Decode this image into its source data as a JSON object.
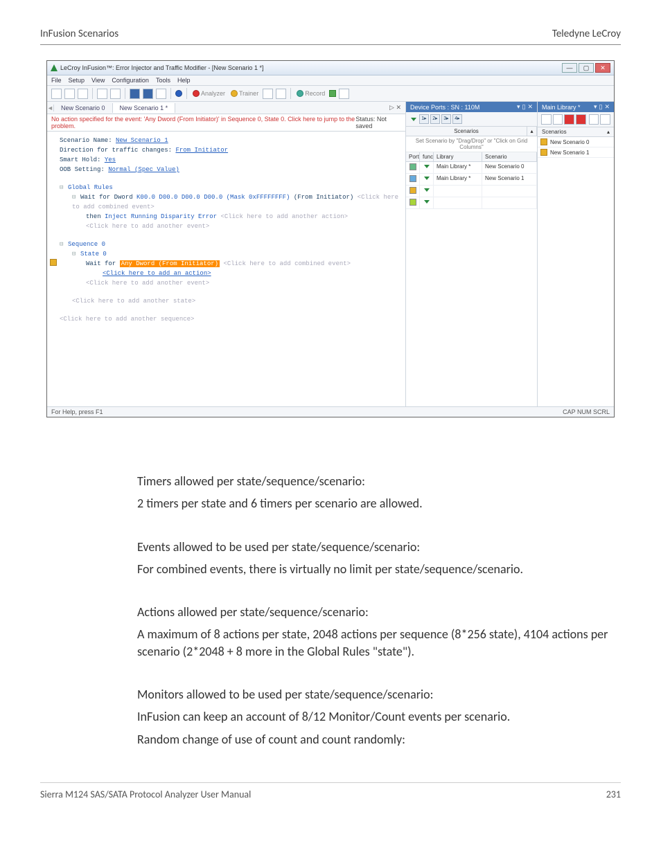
{
  "doc": {
    "header_left": "InFusion Scenarios",
    "header_right": "Teledyne LeCroy",
    "footer_left": "Sierra M124 SAS/SATA Protocol Analyzer User Manual",
    "footer_right": "231"
  },
  "win": {
    "title": "LeCroy InFusion™: Error Injector and Traffic Modifier - [New Scenario 1 *]",
    "menu": [
      "File",
      "Setup",
      "View",
      "Configuration",
      "Tools",
      "Help"
    ]
  },
  "toolbar": {
    "analyzer": "Analyzer",
    "trainer": "Trainer",
    "record": "Record"
  },
  "tabs": {
    "left_marker": "◄",
    "t0": "New Scenario 0",
    "t1": "New Scenario 1 *",
    "close_marker": "▷  ✕"
  },
  "warn": {
    "text": "No action specified for the event: 'Any Dword (From Initiator)' in Sequence 0, State 0.  Click here to jump to the problem.",
    "status": "Status: Not saved"
  },
  "editor": {
    "l1a": "Scenario Name: ",
    "l1b": "New Scenario 1",
    "l2a": "Direction for traffic changes: ",
    "l2b": "From Initiator",
    "l3a": "Smart Hold: ",
    "l3b": "Yes",
    "l4a": "OOB Setting: ",
    "l4b": "Normal (Spec Value)",
    "l5": "Global Rules",
    "l6a": "Wait for Dword ",
    "l6b": "K00.0 D00.0 D00.0 D00.0 (Mask 0xFFFFFFFF)",
    "l6c": " (From Initiator) ",
    "l6d": "<Click here to add combined event>",
    "l7a": "then ",
    "l7b": "Inject Running Disparity Error",
    "l7c": " <Click here to add another action>",
    "l8": "<Click here to add another event>",
    "l9": "Sequence 0",
    "l10": "State 0",
    "l11a": "Wait for ",
    "l11b": "Any Dword (From Initiator)",
    "l11c": " <Click here to add combined event>",
    "l12": "<Click here to add an action>",
    "l13": "<Click here to add another event>",
    "l14": "<Click here to add another state>",
    "l15": "<Click here to add another sequence>"
  },
  "mid": {
    "title": "Device Ports : SN : 110M",
    "hdr_scenarios": "Scenarios",
    "hint": "Set Scenario by \"Drag/Drop\" or \"Click on Grid Columns\"",
    "cols": {
      "port": "Port",
      "func": "func",
      "lib": "Library",
      "scen": "Scenario"
    },
    "rows": [
      {
        "port": "port-a",
        "lib": "Main Library *",
        "scen": "New Scenario 0"
      },
      {
        "port": "port-b",
        "lib": "Main Library *",
        "scen": "New Scenario 1"
      },
      {
        "port": "port-c",
        "lib": "",
        "scen": ""
      },
      {
        "port": "port-d",
        "lib": "",
        "scen": ""
      }
    ]
  },
  "right": {
    "title": "Main Library *",
    "hdr": "Scenarios",
    "rows": [
      "New Scenario 0",
      "New Scenario 1"
    ]
  },
  "statusbar": {
    "left": "For Help, press F1",
    "right": "CAP  NUM  SCRL"
  },
  "body": {
    "p1": "Timers allowed per state/sequence/scenario:",
    "p2": "2 timers per state and 6 timers per scenario are allowed.",
    "p3": "Events allowed to be used per state/sequence/scenario:",
    "p4": "For combined events, there is virtually no limit per state/sequence/scenario.",
    "p5": "Actions allowed per state/sequence/scenario:",
    "p6": "A maximum of 8 actions per state, 2048 actions per sequence (8*256 state), 4104 actions per scenario (2*2048 + 8 more in the Global Rules \"state\").",
    "p7": "Monitors allowed to be used per state/sequence/scenario:",
    "p8": "InFusion can keep an account of 8/12 Monitor/Count events per scenario.",
    "p9": "Random change of use of count and count randomly:"
  }
}
